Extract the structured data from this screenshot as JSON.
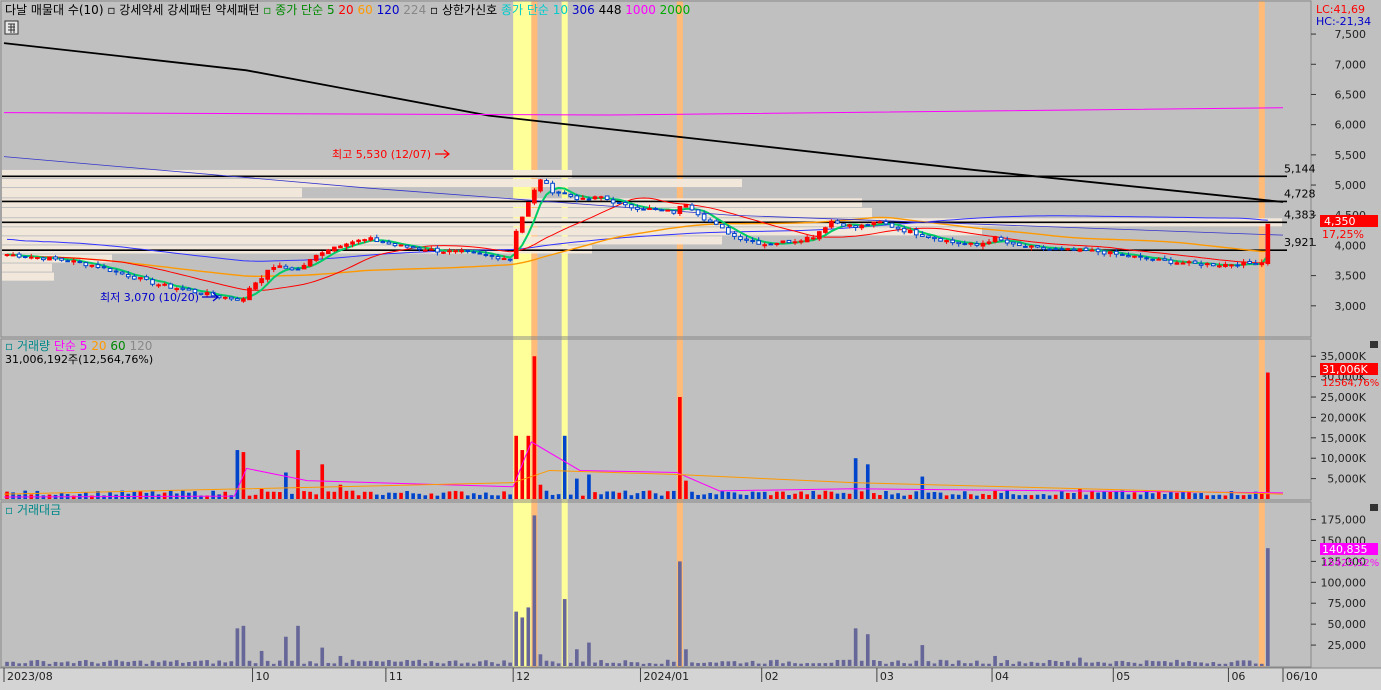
{
  "colors": {
    "background": "#c0c0c0",
    "up": "#ff0000",
    "down": "#0044cc",
    "ma5": "#00cc66",
    "ma20": "#ff0000",
    "ma60": "#ff9900",
    "ma120": "#3333ff",
    "ma224": "#000000",
    "ma1000": "#ff00ff",
    "highlight_yellow": "#ffff99",
    "highlight_orange": "#ffbb77",
    "volume_bar": "#666699"
  },
  "price_panel": {
    "title_items": [
      {
        "text": "다날 매물대 수(10)",
        "color": "#000000"
      },
      {
        "text": "▫ 강세약세 강세패턴 약세패턴",
        "color": "#000000"
      },
      {
        "text": "▫ 종가 단순 5",
        "color": "#008800"
      },
      {
        "text": "20",
        "color": "#ff0000"
      },
      {
        "text": "60",
        "color": "#ff9900"
      },
      {
        "text": "120",
        "color": "#0000cc"
      },
      {
        "text": "224",
        "color": "#888888"
      },
      {
        "text": "▫ 상한가신호",
        "color": "#000000"
      },
      {
        "text": "종가 단순 10",
        "color": "#00cccc"
      },
      {
        "text": "306",
        "color": "#0000cc"
      },
      {
        "text": "448",
        "color": "#000000"
      },
      {
        "text": "1000",
        "color": "#ff00ff"
      },
      {
        "text": "2000",
        "color": "#00aa00"
      }
    ],
    "lc_label": "LC:41,69",
    "hc_label": "HC:-21,34",
    "y_ticks": [
      "7,500",
      "7,000",
      "6,500",
      "6,000",
      "5,500",
      "5,000",
      "4,500",
      "4,000",
      "3,500",
      "3,000"
    ],
    "ylim": [
      2500,
      7700
    ],
    "levels": [
      {
        "label": "5,144",
        "value": 5144
      },
      {
        "label": "4,728",
        "value": 4728
      },
      {
        "label": "4,383",
        "value": 4383
      },
      {
        "label": "3,921",
        "value": 3921
      }
    ],
    "current_price_label": "4,350",
    "current_pct_label": "17,25%",
    "high_annotation": "최고 5,530 (12/07)",
    "low_annotation": "최저 3,070 (10/20)"
  },
  "volume_panel": {
    "title_items": [
      {
        "text": "▫ 거래량",
        "color": "#008888"
      },
      {
        "text": "단순 5",
        "color": "#ff00ff"
      },
      {
        "text": "20",
        "color": "#ff9900"
      },
      {
        "text": "60",
        "color": "#008800"
      },
      {
        "text": "120",
        "color": "#888888"
      }
    ],
    "summary": "31,006,192주(12,564,76%)",
    "y_ticks": [
      "35,000K",
      "30,000K",
      "25,000K",
      "20,000K",
      "15,000K",
      "10,000K",
      "5,000K"
    ],
    "ylim": [
      0,
      38000
    ],
    "current_label": "31,006K",
    "current_pct_label": "12564,76%"
  },
  "amount_panel": {
    "title": "▫ 거래대금",
    "y_ticks": [
      "175,000",
      "150,000",
      "125,000",
      "100,000",
      "75,000",
      "50,000",
      "25,000"
    ],
    "ylim": [
      0,
      190000
    ],
    "current_label": "140,835",
    "current_pct_label": "15425,52%"
  },
  "x_labels": [
    {
      "text": "2023/08",
      "day": 0
    },
    {
      "text": "10",
      "day": 41
    },
    {
      "text": "11",
      "day": 63
    },
    {
      "text": "12",
      "day": 84
    },
    {
      "text": "2024/01",
      "day": 105
    },
    {
      "text": "02",
      "day": 125
    },
    {
      "text": "03",
      "day": 144
    },
    {
      "text": "04",
      "day": 163
    },
    {
      "text": "05",
      "day": 183
    },
    {
      "text": "06",
      "day": 202
    },
    {
      "text": "06/10",
      "day": 211
    }
  ],
  "chart_data": {
    "type": "candlestick",
    "days": 211,
    "highlights": [
      {
        "from_day": 84,
        "to_day": 87,
        "color": "yellow"
      },
      {
        "from_day": 87,
        "to_day": 88,
        "color": "orange"
      },
      {
        "from_day": 92,
        "to_day": 93,
        "color": "yellow"
      },
      {
        "from_day": 111,
        "to_day": 112,
        "color": "orange"
      },
      {
        "from_day": 207,
        "to_day": 208,
        "color": "orange"
      }
    ],
    "close_keypoints": [
      [
        0,
        3850
      ],
      [
        5,
        3800
      ],
      [
        10,
        3750
      ],
      [
        15,
        3650
      ],
      [
        20,
        3500
      ],
      [
        25,
        3350
      ],
      [
        30,
        3250
      ],
      [
        35,
        3150
      ],
      [
        39,
        3100
      ],
      [
        40,
        3300
      ],
      [
        44,
        3650
      ],
      [
        48,
        3600
      ],
      [
        52,
        3900
      ],
      [
        56,
        4050
      ],
      [
        60,
        4100
      ],
      [
        64,
        4000
      ],
      [
        68,
        3950
      ],
      [
        72,
        3900
      ],
      [
        76,
        3880
      ],
      [
        80,
        3820
      ],
      [
        83,
        3780
      ],
      [
        84,
        4250
      ],
      [
        86,
        4700
      ],
      [
        88,
        5100
      ],
      [
        90,
        4900
      ],
      [
        92,
        4850
      ],
      [
        95,
        4750
      ],
      [
        98,
        4800
      ],
      [
        102,
        4650
      ],
      [
        106,
        4600
      ],
      [
        110,
        4550
      ],
      [
        112,
        4700
      ],
      [
        115,
        4450
      ],
      [
        120,
        4150
      ],
      [
        125,
        4020
      ],
      [
        130,
        4080
      ],
      [
        133,
        4150
      ],
      [
        136,
        4400
      ],
      [
        140,
        4300
      ],
      [
        144,
        4380
      ],
      [
        148,
        4250
      ],
      [
        152,
        4150
      ],
      [
        156,
        4050
      ],
      [
        160,
        4000
      ],
      [
        163,
        4120
      ],
      [
        166,
        4000
      ],
      [
        170,
        3950
      ],
      [
        175,
        3920
      ],
      [
        180,
        3900
      ],
      [
        185,
        3820
      ],
      [
        190,
        3750
      ],
      [
        195,
        3700
      ],
      [
        200,
        3680
      ],
      [
        205,
        3700
      ],
      [
        207,
        3720
      ],
      [
        208,
        4350
      ]
    ],
    "volume_spikes_k": [
      [
        10,
        1200
      ],
      [
        38,
        12000
      ],
      [
        39,
        11500
      ],
      [
        42,
        2500
      ],
      [
        46,
        6500
      ],
      [
        48,
        12000
      ],
      [
        52,
        8500
      ],
      [
        55,
        3500
      ],
      [
        84,
        15500
      ],
      [
        85,
        12000
      ],
      [
        86,
        15500
      ],
      [
        87,
        35000
      ],
      [
        88,
        3500
      ],
      [
        92,
        15500
      ],
      [
        94,
        5000
      ],
      [
        96,
        6000
      ],
      [
        111,
        25000
      ],
      [
        112,
        4500
      ],
      [
        122,
        1000
      ],
      [
        140,
        10000
      ],
      [
        142,
        8500
      ],
      [
        151,
        5500
      ],
      [
        163,
        2000
      ],
      [
        177,
        2500
      ],
      [
        208,
        31006
      ]
    ],
    "amount_spikes": [
      [
        38,
        45000
      ],
      [
        39,
        48000
      ],
      [
        42,
        18000
      ],
      [
        46,
        35000
      ],
      [
        48,
        48000
      ],
      [
        52,
        22000
      ],
      [
        55,
        12000
      ],
      [
        84,
        65000
      ],
      [
        85,
        58000
      ],
      [
        86,
        70000
      ],
      [
        87,
        180000
      ],
      [
        88,
        14000
      ],
      [
        92,
        80000
      ],
      [
        94,
        20000
      ],
      [
        96,
        28000
      ],
      [
        111,
        125000
      ],
      [
        112,
        20000
      ],
      [
        140,
        45000
      ],
      [
        142,
        38000
      ],
      [
        151,
        25000
      ],
      [
        163,
        12000
      ],
      [
        177,
        10000
      ],
      [
        208,
        140835
      ]
    ]
  }
}
